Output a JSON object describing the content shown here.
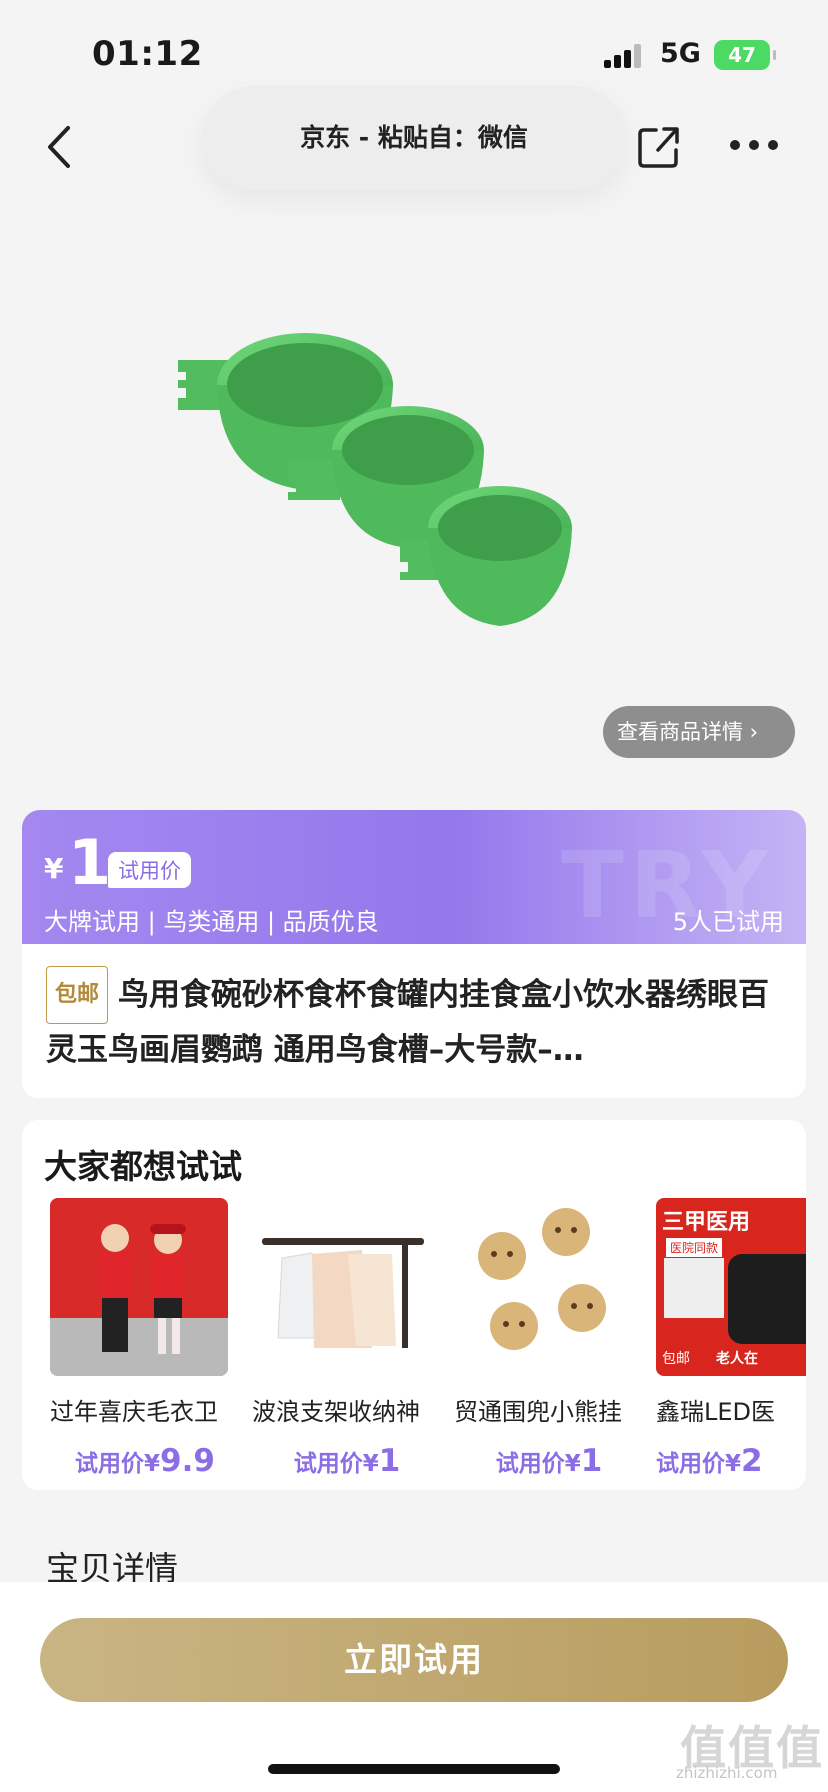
{
  "status_bar": {
    "time": "01:12",
    "network": "5G",
    "battery": "47"
  },
  "nav": {
    "capsule_text": "京东 - 粘贴自：微信"
  },
  "product": {
    "detail_button": "查看商品详情 ›"
  },
  "price_card": {
    "currency": "¥",
    "price": "1",
    "tag": "试用价",
    "features": "大牌试用 | 鸟类通用 | 品质优良",
    "tried_count": "5人已试用",
    "watermark": "TRY"
  },
  "title_card": {
    "badge": "包邮",
    "title": "鸟用食碗砂杯食杯食罐内挂食盒小饮水器绣眼百灵玉鸟画眉鹦鹉 通用鸟食槽–大号款–…"
  },
  "recommendations": {
    "heading": "大家都想试试",
    "items": [
      {
        "name": "过年喜庆毛衣卫",
        "price_label": "试用价¥",
        "price": "9.9"
      },
      {
        "name": "波浪支架收纳神",
        "price_label": "试用价¥",
        "price": "1"
      },
      {
        "name": "贸通围兜小熊挂",
        "price_label": "试用价¥",
        "price": "1"
      },
      {
        "name": "鑫瑞LED医",
        "price_label": "试用价¥",
        "price": "2",
        "img_text_top": "三甲医用",
        "img_text_mid": "医院同款",
        "img_text_bottom1": "包邮",
        "img_text_bottom2": "老人在"
      }
    ]
  },
  "section": {
    "details_label": "宝贝详情"
  },
  "cta": {
    "label": "立即试用"
  },
  "watermark": {
    "logo": "值值值",
    "url": "zhizhizhi.com"
  },
  "colors": {
    "accent_purple": "#9478ec",
    "gold": "#b89c5e",
    "green": "#5cc96a"
  }
}
